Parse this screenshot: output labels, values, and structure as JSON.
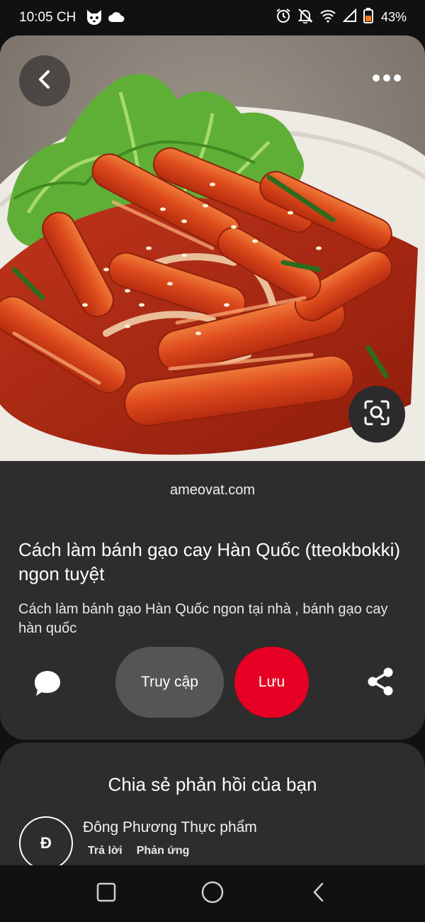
{
  "status_bar": {
    "time": "10:05 CH",
    "battery": "43%",
    "icons": [
      "cat-face-icon",
      "cloud-icon",
      "alarm-icon",
      "bell-off-icon",
      "wifi-icon",
      "signal-icon",
      "battery-icon"
    ]
  },
  "pin": {
    "source": "ameovat.com",
    "title": "Cách làm bánh gạo cay Hàn Quốc (tteokbokki) ngon tuyệt",
    "description": "Cách làm bánh gạo Hàn Quốc ngon tại nhà , bánh gạo cay hàn quốc"
  },
  "actions": {
    "visit_label": "Truy cập",
    "save_label": "Lưu"
  },
  "feedback": {
    "title": "Chia sẻ phản hồi của bạn",
    "avatar_letter": "Đ",
    "author": "Đông Phương Thực phẩm",
    "reply_label": "Trả lời",
    "react_label": "Phản ứng"
  },
  "colors": {
    "save_red": "#e60023",
    "card_bg": "#2d2d2d",
    "visit_bg": "#555555"
  }
}
